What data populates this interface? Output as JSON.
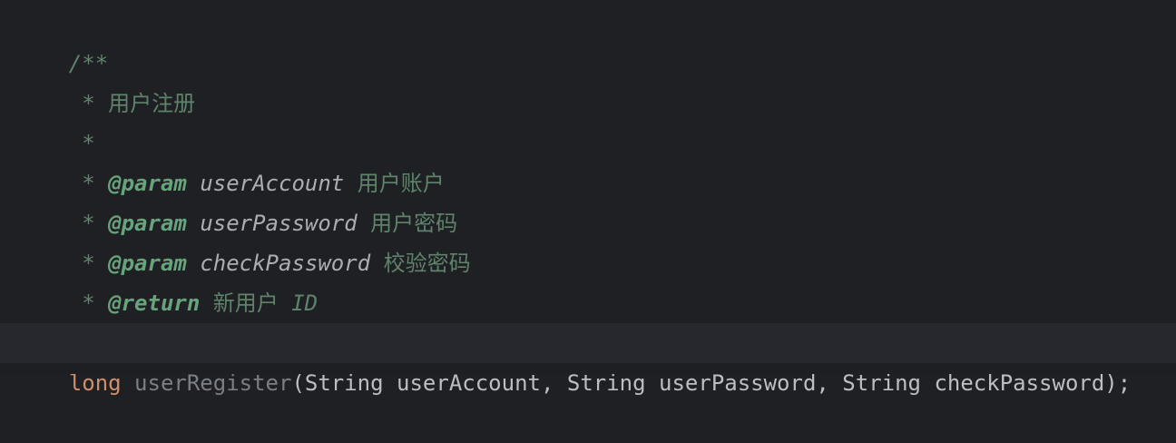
{
  "comment": {
    "open": "/**",
    "title_star": " * ",
    "title": "用户注册",
    "blank": " *",
    "params": [
      {
        "star": " * ",
        "tag": "@param",
        "name": "userAccount",
        "desc": "用户账户"
      },
      {
        "star": " * ",
        "tag": "@param",
        "name": "userPassword",
        "desc": "用户密码"
      },
      {
        "star": " * ",
        "tag": "@param",
        "name": "checkPassword",
        "desc": "校验密码"
      }
    ],
    "return_star": " * ",
    "return_tag": "@return",
    "return_desc_cjk": "新用户",
    "return_desc_id": "ID",
    "close": " */"
  },
  "signature": {
    "keyword": "long",
    "method": "userRegister",
    "rest": "(String userAccount, String userPassword, String checkPassword);"
  },
  "colors": {
    "background": "#1f2023",
    "doc_comment": "#5f826b",
    "doc_tag": "#67a37c",
    "keyword": "#cf8e6d",
    "text": "#bcbec4",
    "unused": "#7a7e85"
  }
}
